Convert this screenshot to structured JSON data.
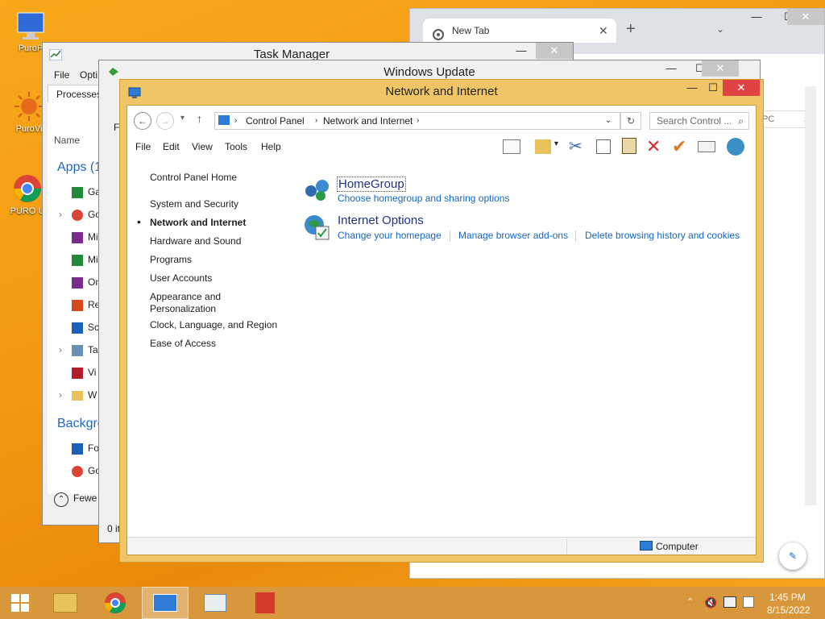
{
  "desktop": {
    "icons": [
      {
        "label": "PuroP"
      },
      {
        "label": "PuroVi"
      },
      {
        "label": "PURO U"
      }
    ]
  },
  "chrome": {
    "tab_title": "New Tab",
    "new_tab_symbol": "+",
    "search_hint": "PC"
  },
  "task_manager": {
    "title": "Task Manager",
    "menu": [
      "File",
      "Opti"
    ],
    "tab": "Processes",
    "column_name": "Name",
    "apps_header": "Apps (1",
    "apps": [
      "Ga",
      "Go",
      "Mi",
      "Mi",
      "On",
      "Re",
      "Sc",
      "Ta",
      "Vi",
      "W"
    ],
    "background_header": "Backgro",
    "background": [
      "Fo",
      "Go"
    ],
    "fewer_label": "Fewe"
  },
  "windows_update": {
    "title": "Windows Update",
    "menu_fragment": "Fi",
    "status_fragment": "0 it"
  },
  "network": {
    "title": "Network and Internet",
    "breadcrumb": [
      "Control Panel",
      "Network and Internet"
    ],
    "search_placeholder": "Search Control ...",
    "menu": [
      "File",
      "Edit",
      "View",
      "Tools",
      "Help"
    ],
    "nav": [
      "Control Panel Home",
      "System and Security",
      "Network and Internet",
      "Hardware and Sound",
      "Programs",
      "User Accounts",
      "Appearance and",
      "Personalization",
      "Clock, Language, and Region",
      "Ease of Access"
    ],
    "homegroup": {
      "title": "HomeGroup",
      "link1": "Choose homegroup and sharing options"
    },
    "internet_options": {
      "title": "Internet Options",
      "links": [
        "Change your homepage",
        "Manage browser add-ons",
        "Delete browsing history and cookies"
      ]
    },
    "status_computer": "Computer"
  },
  "taskbar": {
    "time": "1:45 PM",
    "date": "8/15/2022"
  },
  "colors": {
    "accent_window": "#f0c568",
    "close_red": "#e04343",
    "link_blue": "#1565c0"
  }
}
